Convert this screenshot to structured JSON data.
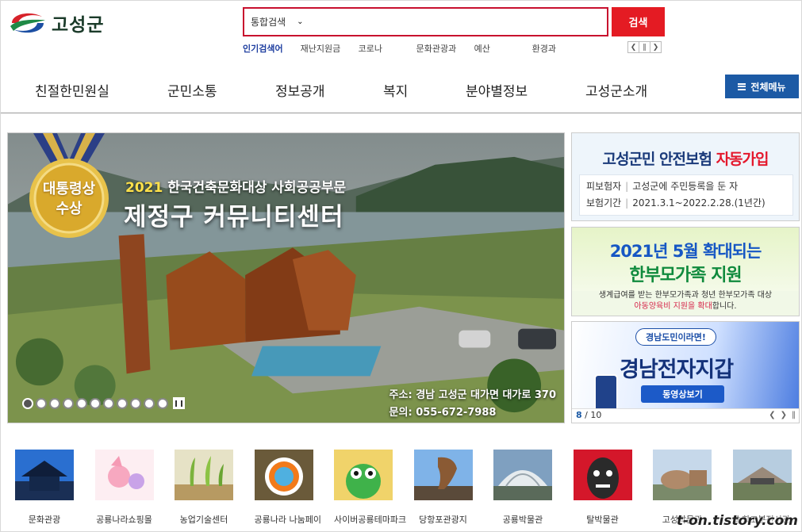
{
  "header": {
    "logo_text": "고성군",
    "search": {
      "scope": "통합검색",
      "placeholder": "",
      "button": "검색"
    },
    "popular": {
      "label": "인기검색어",
      "keywords": [
        "재난지원금",
        "코로나",
        "문화관광과",
        "예산",
        "환경과"
      ]
    }
  },
  "gnb": {
    "items": [
      "친절한민원실",
      "군민소통",
      "정보공개",
      "복지",
      "분야별정보",
      "고성군소개"
    ],
    "all_menu": "전체메뉴"
  },
  "visual": {
    "medal_line1": "대통령상",
    "medal_line2": "수상",
    "award_year": "2021",
    "award_name": "한국건축문화대상 사회공공부문",
    "title": "제정구 커뮤니티센터",
    "address": "주소: 경남 고성군 대가면 대가로 370",
    "phone": "문의: 055-672-7988",
    "slide_count": 11,
    "active_slide": 1
  },
  "banners": {
    "b1": {
      "title_a": "고성군민 안전보험",
      "title_b": "자동가입",
      "row1_k": "피보험자",
      "row1_v": "고성군에 주민등록을 둔 자",
      "row2_k": "보험기간",
      "row2_v": "2021.3.1~2022.2.28.(1년간)"
    },
    "b2": {
      "title": "2021년 5월 확대되는",
      "subtitle": "한부모가족 지원",
      "desc1": "생계급여를 받는 한부모가족과 청년 한부모가족 대상",
      "desc2_hl": "아동양육비 지원을 확대",
      "desc2_tail": "합니다."
    },
    "b3": {
      "pill": "경남도민이라면!",
      "title": "경남전자지갑",
      "button": "동영상보기",
      "current": "8",
      "total": "/ 10"
    }
  },
  "quick_links": [
    {
      "label": "문화관광",
      "icon": "pavilion-icon"
    },
    {
      "label": "공룡나라쇼핑몰",
      "icon": "dinosaur-mall-icon"
    },
    {
      "label": "농업기술센터",
      "icon": "sprout-icon"
    },
    {
      "label": "공룡나라 나눔페이",
      "icon": "nanum-pay-icon"
    },
    {
      "label": "사이버공룡테마파크",
      "icon": "cyber-dino-icon"
    },
    {
      "label": "당항포관광지",
      "icon": "dragon-statue-icon"
    },
    {
      "label": "공룡박물관",
      "icon": "museum-dome-icon"
    },
    {
      "label": "탈박물관",
      "icon": "mask-icon"
    },
    {
      "label": "고성박물관",
      "icon": "museum-building-icon"
    },
    {
      "label": "송학고분전시관",
      "icon": "exhibition-hall-icon"
    }
  ],
  "watermark": "t-on.tistory.com",
  "colors": {
    "brand_red": "#e41b23",
    "brand_blue": "#1c5aa5",
    "keyword_label": "#1f3fa0"
  }
}
